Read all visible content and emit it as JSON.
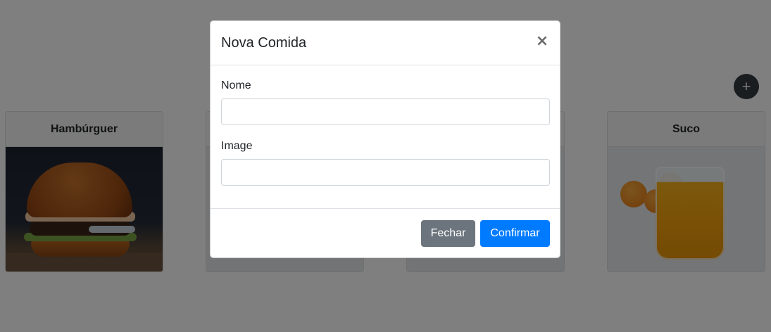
{
  "page": {
    "add_button_label": "+",
    "cards": [
      {
        "title": "Hambúrguer",
        "image": "hamburger-photo"
      },
      {
        "title": "",
        "image": "hidden-photo"
      },
      {
        "title": "",
        "image": "plate-photo"
      },
      {
        "title": "Suco",
        "image": "orange-juice-photo"
      }
    ]
  },
  "modal": {
    "title": "Nova Comida",
    "close_label": "×",
    "fields": [
      {
        "label": "Nome",
        "value": "",
        "placeholder": ""
      },
      {
        "label": "Image",
        "value": "",
        "placeholder": ""
      }
    ],
    "buttons": {
      "close": "Fechar",
      "confirm": "Confirmar"
    }
  },
  "colors": {
    "primary": "#007bff",
    "secondary": "#6c757d",
    "fab": "#343a40",
    "backdrop": "rgba(0,0,0,0.5)"
  }
}
